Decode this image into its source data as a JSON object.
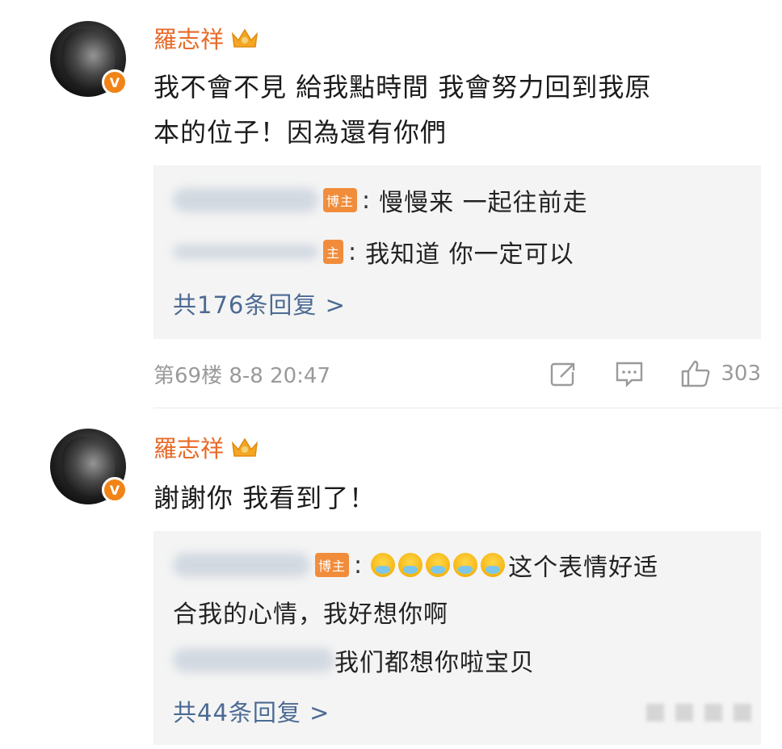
{
  "comments": [
    {
      "username": "羅志祥",
      "verified_badge": "V",
      "text_line1": "我不會不見 給我點時間 我會努力回到我原",
      "text_line2": "本的位子！因為還有你們",
      "replies": [
        {
          "badge": "博主",
          "text": "慢慢来 一起往前走"
        },
        {
          "badge": "主",
          "text": "我知道 你一定可以"
        }
      ],
      "more_replies": "共176条回复 >",
      "meta": "第69楼 8-8 20:47",
      "like_count": "303"
    },
    {
      "username": "羅志祥",
      "verified_badge": "V",
      "text_line1": "謝謝你 我看到了！",
      "replies": [
        {
          "badge": "博主",
          "text_line1": "这个表情好适",
          "text_line2": "合我的心情，我好想你啊"
        },
        {
          "text": "我们都想你啦宝贝"
        }
      ],
      "more_replies": "共44条回复 >"
    }
  ],
  "icons": {
    "crown": "crown-icon",
    "share": "share-icon",
    "comment": "comment-icon",
    "like": "thumbs-up-icon",
    "emoji": "crying-face-icon"
  },
  "colors": {
    "username": "#e86a28",
    "link": "#4b6a93",
    "badge": "#f18c3a",
    "reply_bg": "#f4f4f4",
    "meta": "#9a9a9a"
  }
}
